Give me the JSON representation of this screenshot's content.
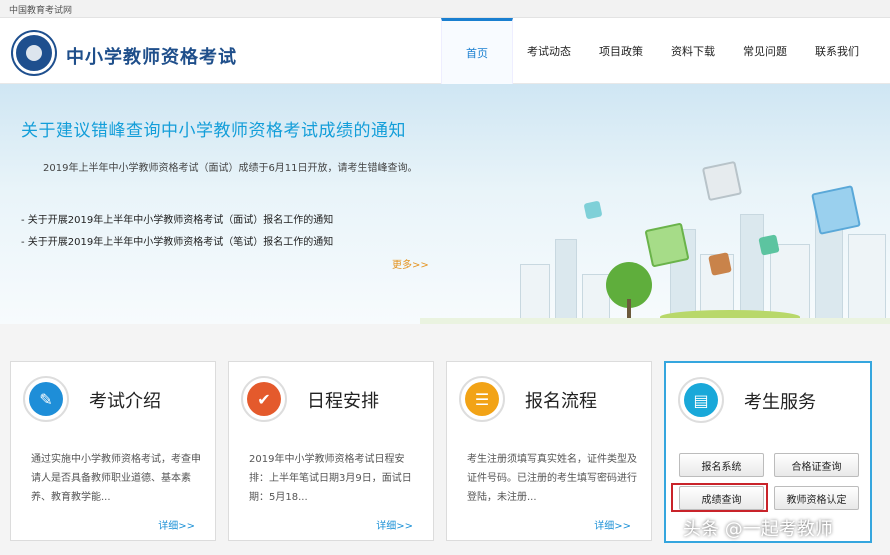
{
  "topbar": {
    "site_name": "中国教育考试网"
  },
  "header": {
    "title": "中小学教师资格考试",
    "nav": [
      "首页",
      "考试动态",
      "项目政策",
      "资料下载",
      "常见问题",
      "联系我们"
    ],
    "active_nav": "首页"
  },
  "banner": {
    "title": "关于建议错峰查询中小学教师资格考试成绩的通知",
    "text": "2019年上半年中小学教师资格考试（面试）成绩于6月11日开放，请考生错峰查询。",
    "links": [
      "关于开展2019年上半年中小学教师资格考试（面试）报名工作的通知",
      "关于开展2019年上半年中小学教师资格考试（笔试）报名工作的通知"
    ],
    "more": "更多>>"
  },
  "cards": [
    {
      "title": "考试介绍",
      "icon": "document-edit-icon",
      "color": "#1e8ed8",
      "desc": "通过实施中小学教师资格考试，考查申请人是否具备教师职业道德、基本素养、教育教学能...",
      "more": "详细>>"
    },
    {
      "title": "日程安排",
      "icon": "checkmark-icon",
      "color": "#e45a2c",
      "desc": "2019年中小学教师资格考试日程安排：上半年笔试日期3月9日，面试日期：5月18...",
      "more": "详细>>"
    },
    {
      "title": "报名流程",
      "icon": "form-pencil-icon",
      "color": "#f2a316",
      "desc": "考生注册须填写真实姓名，证件类型及证件号码。已注册的考生填写密码进行登陆，未注册...",
      "more": "详细>>"
    }
  ],
  "service": {
    "title": "考生服务",
    "icon": "address-book-icon",
    "color": "#19a8d9",
    "buttons": [
      "报名系统",
      "合格证查询",
      "成绩查询",
      "教师资格认定"
    ]
  },
  "watermark": "头条 @一起考教师"
}
